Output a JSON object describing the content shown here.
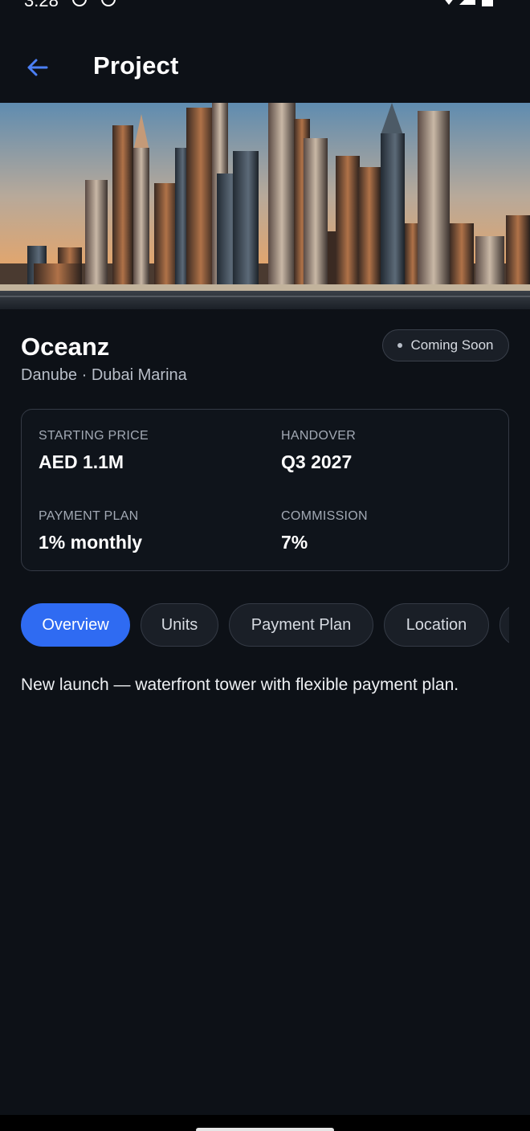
{
  "status_bar": {
    "time": "3:28"
  },
  "app_bar": {
    "title": "Project"
  },
  "project": {
    "name": "Oceanz",
    "developer": "Danube",
    "location": "Dubai Marina",
    "subtitle": "Danube · Dubai Marina",
    "status": "Coming Soon"
  },
  "details": {
    "starting_price_label": "STARTING PRICE",
    "starting_price_value": "AED 1.1M",
    "handover_label": "HANDOVER",
    "handover_value": "Q3 2027",
    "payment_plan_label": "PAYMENT PLAN",
    "payment_plan_value": "1% monthly",
    "commission_label": "COMMISSION",
    "commission_value": "7%"
  },
  "tabs": [
    {
      "label": "Overview",
      "active": true
    },
    {
      "label": "Units",
      "active": false
    },
    {
      "label": "Payment Plan",
      "active": false
    },
    {
      "label": "Location",
      "active": false
    }
  ],
  "overview": {
    "description": "New launch — waterfront tower with flexible payment plan."
  },
  "colors": {
    "background": "#0d1117",
    "accent": "#2f6bf2",
    "card_border": "#343a45",
    "muted_text": "#a2a9b4"
  },
  "icons": {
    "back": "arrow-left-icon",
    "status_dot": "dot-icon"
  }
}
